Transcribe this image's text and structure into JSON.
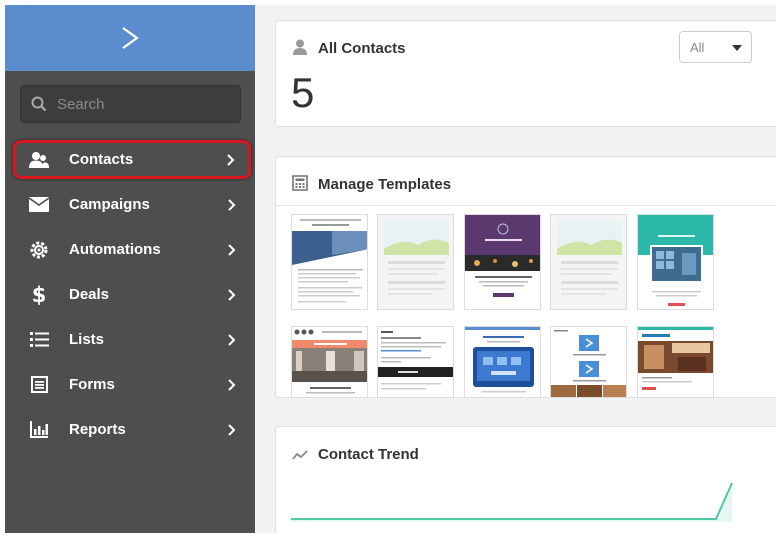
{
  "sidebar": {
    "logo_icon": "chevron-logo-icon",
    "search_placeholder": "Search",
    "items": [
      {
        "label": "Contacts",
        "icon": "contacts-icon",
        "active": true
      },
      {
        "label": "Campaigns",
        "icon": "envelope-icon"
      },
      {
        "label": "Automations",
        "icon": "automation-gear-icon"
      },
      {
        "label": "Deals",
        "icon": "dollar-icon"
      },
      {
        "label": "Lists",
        "icon": "list-icon"
      },
      {
        "label": "Forms",
        "icon": "form-icon"
      },
      {
        "label": "Reports",
        "icon": "bar-chart-icon"
      }
    ]
  },
  "contacts_card": {
    "title": "All Contacts",
    "count": "5",
    "filter_value": "All"
  },
  "templates_card": {
    "title": "Manage Templates"
  },
  "trend_card": {
    "title": "Contact Trend"
  },
  "colors": {
    "sidebar_bg": "#4e4e4e",
    "logo_bar": "#5b8ccd",
    "active_outline": "#d8161e",
    "trend_line": "#52c7a8"
  }
}
